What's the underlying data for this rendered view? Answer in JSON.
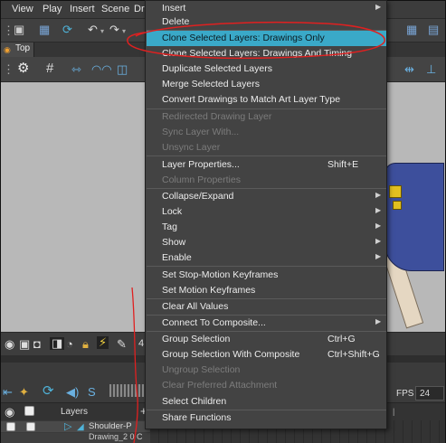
{
  "menubar": {
    "items": [
      "View",
      "Play",
      "Insert",
      "Scene",
      "Dr"
    ]
  },
  "tab": {
    "label": "Top"
  },
  "context_menu": {
    "items": [
      {
        "label": "Insert",
        "submenu": true
      },
      {
        "label": "Delete"
      },
      {
        "label": "Clone Selected Layers: Drawings Only",
        "highlighted": true
      },
      {
        "label": "Clone Selected Layers: Drawings And Timing"
      },
      {
        "label": "Duplicate Selected Layers"
      },
      {
        "label": "Merge Selected Layers"
      },
      {
        "label": "Convert Drawings to Match Art Layer Type"
      },
      {
        "label": "Redirected Drawing Layer",
        "disabled": true
      },
      {
        "label": "Sync Layer With...",
        "disabled": true
      },
      {
        "label": "Unsync Layer",
        "disabled": true
      },
      {
        "label": "Layer Properties...",
        "shortcut": "Shift+E"
      },
      {
        "label": "Column Properties",
        "disabled": true
      },
      {
        "label": "Collapse/Expand",
        "submenu": true
      },
      {
        "label": "Lock",
        "submenu": true
      },
      {
        "label": "Tag",
        "submenu": true
      },
      {
        "label": "Show",
        "submenu": true
      },
      {
        "label": "Enable",
        "submenu": true
      },
      {
        "label": "Set Stop-Motion Keyframes"
      },
      {
        "label": "Set Motion Keyframes"
      },
      {
        "label": "Clear All Values"
      },
      {
        "label": "Connect To Composite...",
        "submenu": true
      },
      {
        "label": "Group Selection",
        "shortcut": "Ctrl+G"
      },
      {
        "label": "Group Selection With Composite",
        "shortcut": "Ctrl+Shift+G"
      },
      {
        "label": "Ungroup Selection",
        "disabled": true
      },
      {
        "label": "Clear Preferred Attachment",
        "disabled": true
      },
      {
        "label": "Select Children"
      },
      {
        "label": "Share Functions"
      }
    ]
  },
  "timeline": {
    "layers_label": "Layers",
    "fps_label": "FPS",
    "fps_value": "24",
    "zoom_partial": "4",
    "layer_row_name": "Shoulder-P",
    "layer_row_name2": "Drawing_2 0 C"
  },
  "colors": {
    "highlight": "#3aa9c8",
    "annotation": "#e02020"
  }
}
